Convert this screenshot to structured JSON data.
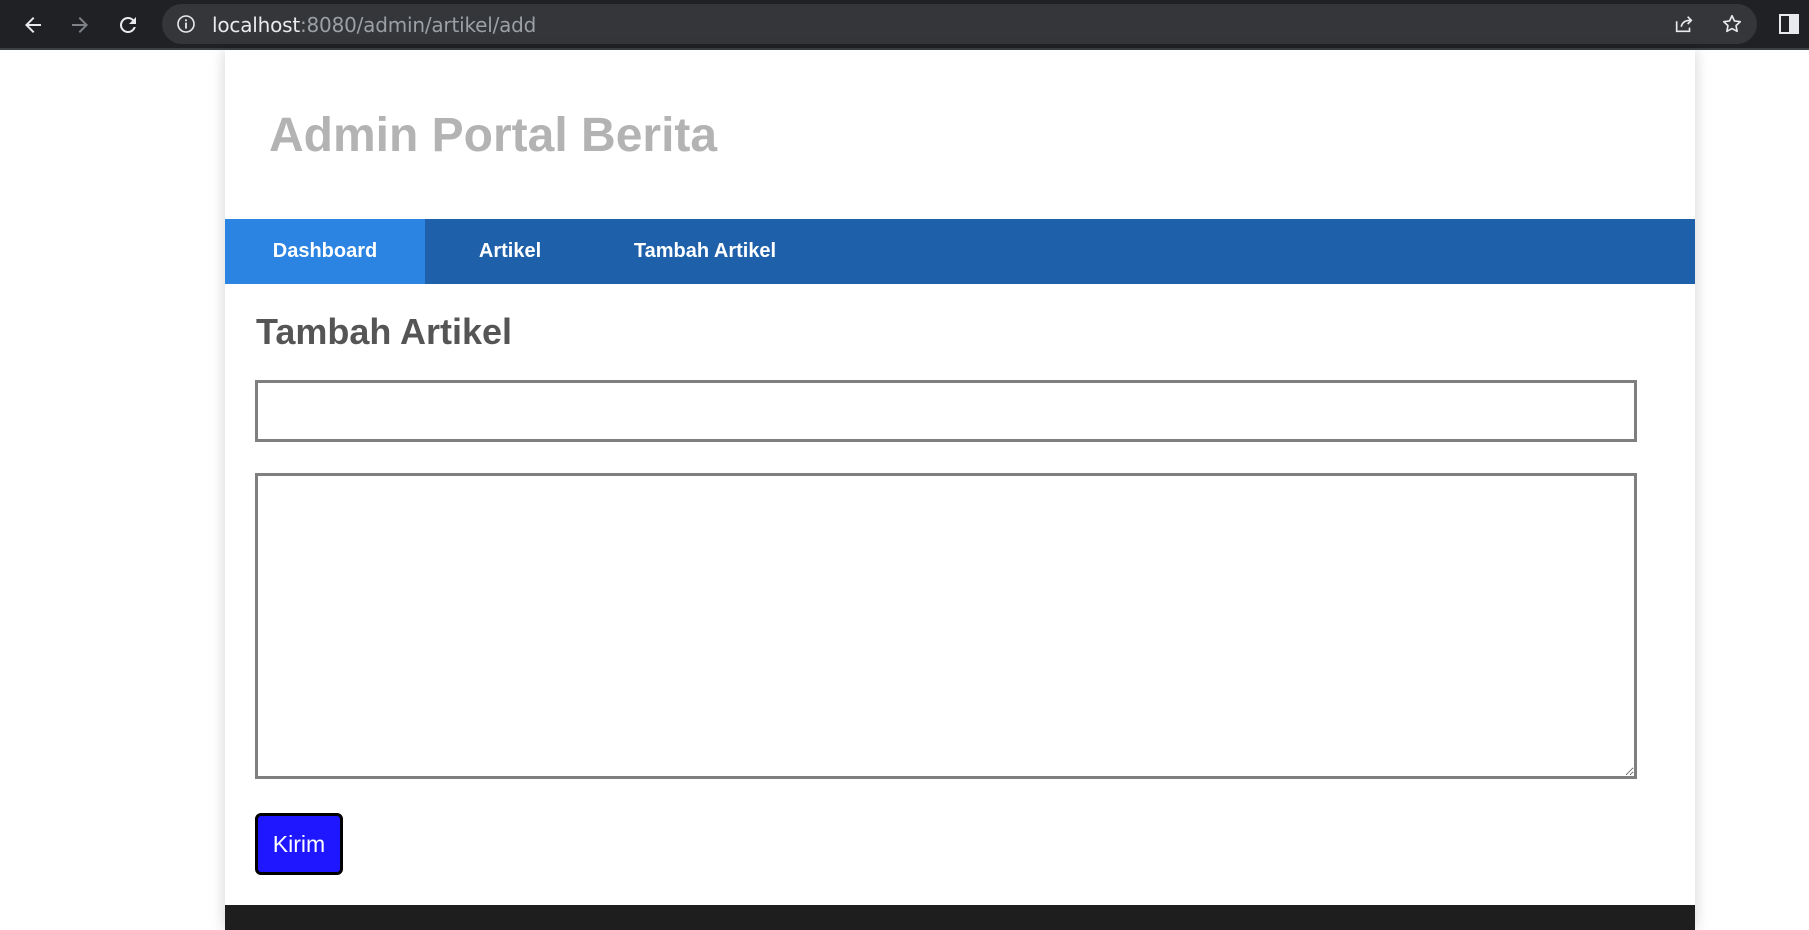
{
  "browser": {
    "url_host": "localhost",
    "url_rest": ":8080/admin/artikel/add",
    "icons": [
      "back-icon",
      "forward-icon",
      "reload-icon",
      "info-icon",
      "share-icon",
      "star-icon",
      "side-panel-icon"
    ],
    "chrome_color": "#202124"
  },
  "header": {
    "title": "Admin Portal Berita"
  },
  "nav": {
    "items": [
      {
        "label": "Dashboard",
        "active": true
      },
      {
        "label": "Artikel",
        "active": false
      },
      {
        "label": "Tambah Artikel",
        "active": false
      }
    ],
    "bar_color": "#1f60aa",
    "active_color": "#2b83e2"
  },
  "main": {
    "heading": "Tambah Artikel",
    "title_input": {
      "value": "",
      "placeholder": ""
    },
    "content_textarea": {
      "value": "",
      "placeholder": ""
    },
    "submit_label": "Kirim",
    "submit_color": "#1e17ff"
  }
}
